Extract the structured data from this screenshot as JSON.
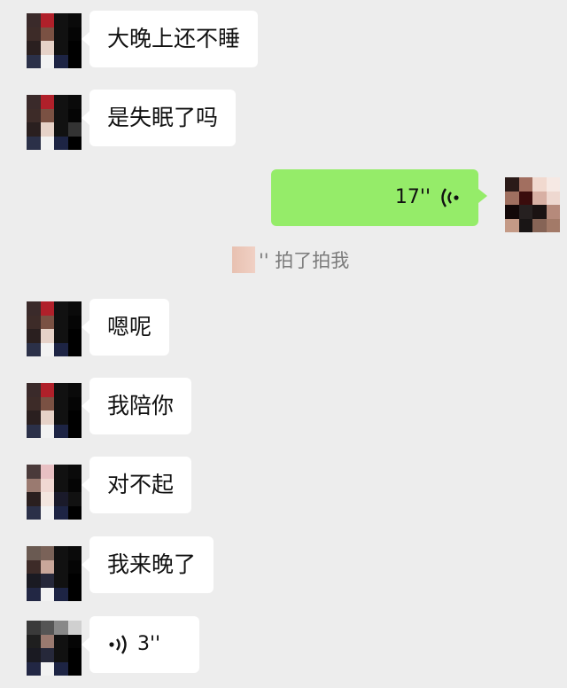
{
  "messages": [
    {
      "side": "left",
      "text": "大晚上还不睡"
    },
    {
      "side": "left",
      "text": "是失眠了吗"
    },
    {
      "side": "right",
      "voice_duration": "17''"
    },
    {
      "side": "system",
      "text": "'' 拍了拍我"
    },
    {
      "side": "left",
      "text": "嗯呢"
    },
    {
      "side": "left",
      "text": "我陪你"
    },
    {
      "side": "left",
      "text": "对不起"
    },
    {
      "side": "left",
      "text": "我来晚了"
    },
    {
      "side": "left",
      "voice_duration": "3''"
    }
  ],
  "colors": {
    "background": "#ededed",
    "incoming_bubble": "#ffffff",
    "outgoing_bubble": "#95ec69",
    "system_text": "#7b7b7b"
  },
  "icons": {
    "voice_outgoing": "voice-wave-icon",
    "voice_incoming": "voice-wave-icon"
  }
}
